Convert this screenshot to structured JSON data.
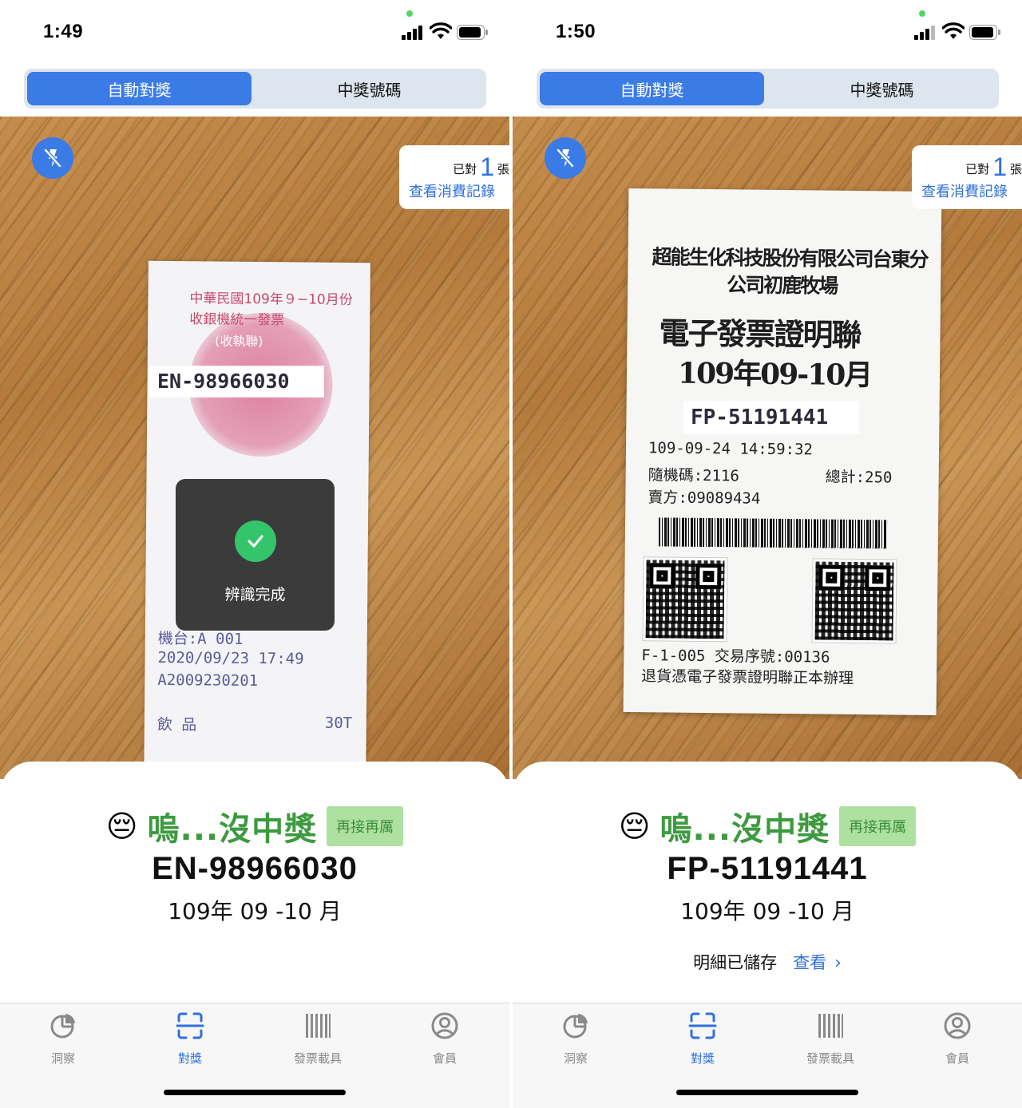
{
  "colors": {
    "accent": "#3a7be6",
    "win_green": "#3d9b3f",
    "badge_bg": "#aee0a0",
    "toast_bg": "#3b3b3b",
    "check_green": "#34c46a"
  },
  "screens": [
    {
      "status": {
        "time": "1:49"
      },
      "segments": {
        "auto_check": "自動對獎",
        "winning_numbers": "中獎號碼"
      },
      "camera": {
        "flash_icon": "flash-off-icon",
        "counter": {
          "prefix": "已對",
          "count": "1",
          "suffix": "張",
          "history_link": "查看消費記錄"
        },
        "receipt": {
          "line1": "中華民國109年９−10月份",
          "line2": "收銀機統一發票",
          "line3": "(收執聯)",
          "number": "EN-98966030",
          "line4": "機台:A  001",
          "line5": "2020/09/23 17:49",
          "line6": "A2009230201",
          "line7": "飲 品",
          "line8": "30T"
        },
        "toast": {
          "icon": "check-circle-icon",
          "label": "辨識完成"
        }
      },
      "result": {
        "emoji": "😔",
        "title": "嗚...沒中獎",
        "badge": "再接再厲",
        "invoice_no": "EN-98966030",
        "period": "109年 09 -10 月"
      },
      "tabs": [
        {
          "label": "洞察",
          "icon": "pie-chart-icon",
          "active": false
        },
        {
          "label": "對獎",
          "icon": "scan-icon",
          "active": true
        },
        {
          "label": "發票載具",
          "icon": "barcode-icon",
          "active": false
        },
        {
          "label": "會員",
          "icon": "user-circle-icon",
          "active": false
        }
      ]
    },
    {
      "status": {
        "time": "1:50"
      },
      "segments": {
        "auto_check": "自動對獎",
        "winning_numbers": "中獎號碼"
      },
      "camera": {
        "flash_icon": "flash-off-icon",
        "counter": {
          "prefix": "已對",
          "count": "1",
          "suffix": "張",
          "history_link": "查看消費記錄"
        },
        "receipt": {
          "company1": "超能生化科技股份有限公司台東分",
          "company2": "公司初鹿牧場",
          "doc_title": "電子發票證明聯",
          "doc_period": "109年09-10月",
          "number": "FP-51191441",
          "datetime": "109-09-24 14:59:32",
          "random_code": "隨機碼:2116",
          "total": "總計:250",
          "seller": "賣方:09089434",
          "terminal": "F-1-005 交易序號:00136",
          "return_note": "退貨憑電子發票證明聯正本辦理"
        }
      },
      "result": {
        "emoji": "😔",
        "title": "嗚...沒中獎",
        "badge": "再接再厲",
        "invoice_no": "FP-51191441",
        "period": "109年 09 -10 月",
        "saved_label": "明細已儲存",
        "view_link": "查看",
        "chevron": "›"
      },
      "tabs": [
        {
          "label": "洞察",
          "icon": "pie-chart-icon",
          "active": false
        },
        {
          "label": "對獎",
          "icon": "scan-icon",
          "active": true
        },
        {
          "label": "發票載具",
          "icon": "barcode-icon",
          "active": false
        },
        {
          "label": "會員",
          "icon": "user-circle-icon",
          "active": false
        }
      ]
    }
  ]
}
